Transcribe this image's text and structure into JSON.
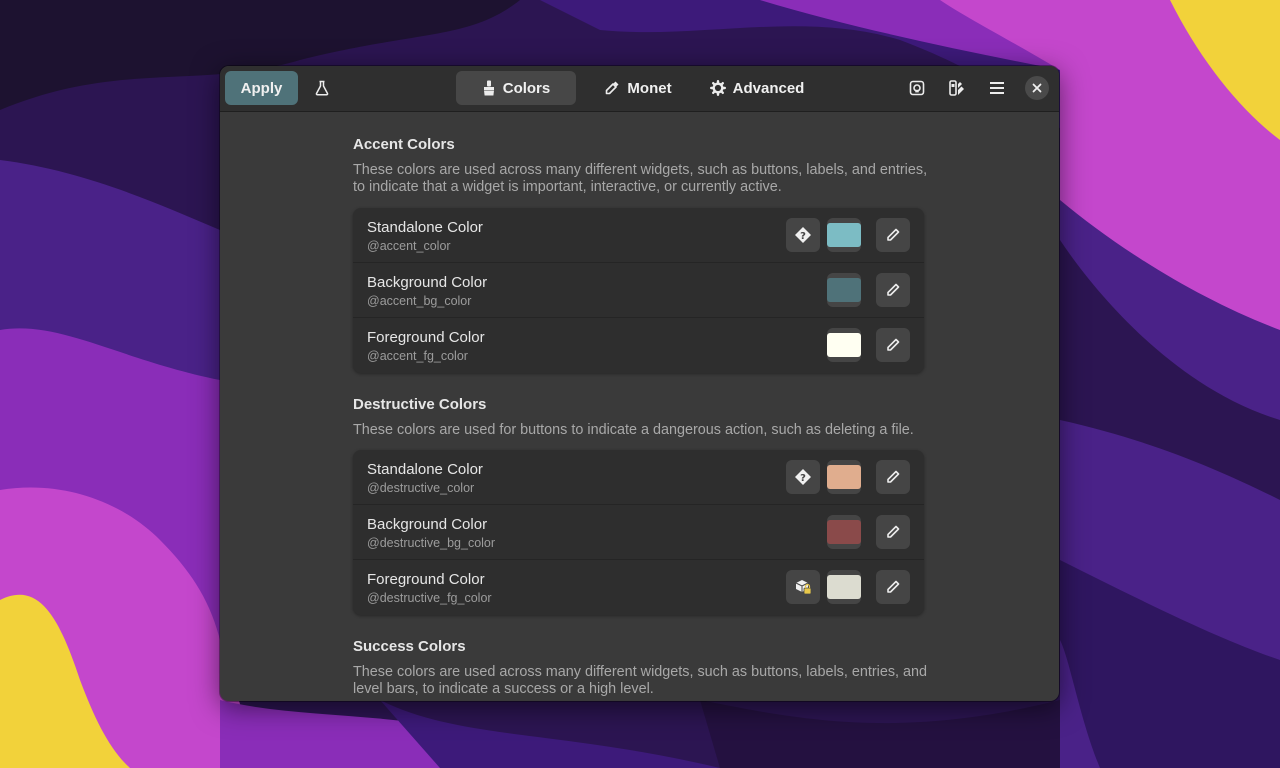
{
  "header": {
    "apply_label": "Apply",
    "tabs": [
      {
        "label": "Colors",
        "icon": "brush-icon",
        "active": true
      },
      {
        "label": "Monet",
        "icon": "eyedropper-icon",
        "active": false
      },
      {
        "label": "Advanced",
        "icon": "gear-icon",
        "active": false
      }
    ],
    "icons": [
      "flask-icon",
      "palette-doc-icon",
      "swatches-icon",
      "hamburger-menu-icon",
      "close-icon"
    ]
  },
  "sections": [
    {
      "title": "Accent Colors",
      "description": "These colors are used across many different widgets, such as buttons, labels, and entries, to indicate that a widget is important, interactive, or currently active.",
      "rows": [
        {
          "title": "Standalone Color",
          "variable": "@accent_color",
          "color": "#7cbcc4",
          "indicator": "help-diamond-icon"
        },
        {
          "title": "Background Color",
          "variable": "@accent_bg_color",
          "color": "#4f7279"
        },
        {
          "title": "Foreground Color",
          "variable": "@accent_fg_color",
          "color": "#fffff2"
        }
      ]
    },
    {
      "title": "Destructive Colors",
      "description": "These colors are used for buttons to indicate a dangerous action, such as deleting a file.",
      "rows": [
        {
          "title": "Standalone Color",
          "variable": "@destructive_color",
          "color": "#e0ad8e",
          "indicator": "help-diamond-icon"
        },
        {
          "title": "Background Color",
          "variable": "@destructive_bg_color",
          "color": "#8a4a4a"
        },
        {
          "title": "Foreground Color",
          "variable": "@destructive_fg_color",
          "color": "#dcdcd0",
          "indicator": "package-lock-icon"
        }
      ]
    },
    {
      "title": "Success Colors",
      "description": "These colors are used across many different widgets, such as buttons, labels, entries, and level bars, to indicate a success or a high level."
    }
  ],
  "colors": {
    "accent": "#4f7279",
    "window_bg": "#3a3a3a",
    "headerbar_bg": "#2f2f2f",
    "card_bg": "#2e2e2e"
  }
}
